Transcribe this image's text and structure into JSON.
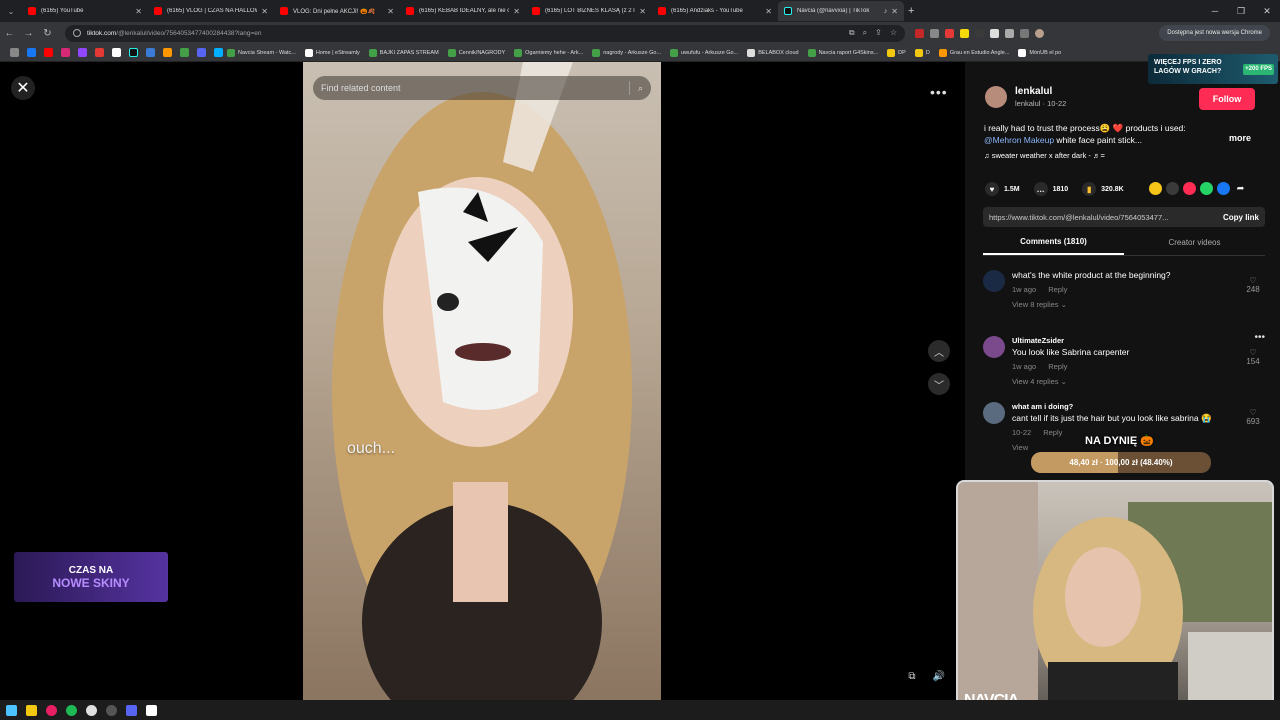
{
  "browser": {
    "tabs": [
      {
        "title": "(6165) YouTube",
        "kind": "yt"
      },
      {
        "title": "(6165) VLOG | CZAS NA HALLOWE",
        "kind": "yt"
      },
      {
        "title": "VLOG: Dni pełne AKCJI! 🎃🍂",
        "kind": "yt"
      },
      {
        "title": "(6165) KEBAB IDEALNY, ale nie ch",
        "kind": "yt"
      },
      {
        "title": "(6165) LOT BIZNES KLASĄ (z 2 letn",
        "kind": "yt"
      },
      {
        "title": "(6165) Andziaks - YouTube",
        "kind": "yt"
      },
      {
        "title": "Navcia (@navvxia) | TikTok",
        "kind": "tt",
        "active": true
      }
    ],
    "url_host": "tiktok.com",
    "url_path": "/@lenkalul/video/7564053477400284438?lang=en",
    "update_label": "Dostępna jest nowa wersja Chrome",
    "bookmarks": [
      "Navcia Stream - Watc...",
      "Home | eStreamly",
      "BAJKI ZAPAS STREAM",
      "Cennik/NAGRODY",
      "Ogarniemy hehe - Ark...",
      "nagrody - Arkusze Go...",
      "uwufufu - Arkusze Go...",
      "BELABOX cloud",
      "Navcia raport G4Skins...",
      "DP",
      "D",
      "Grau en Estudio Angle...",
      "MónUB el po"
    ]
  },
  "video": {
    "search_placeholder": "Find related content",
    "caption": "ouch..."
  },
  "post": {
    "username": "lenkalul",
    "meta": "lenkalul · 10-22",
    "follow_label": "Follow",
    "description": "i really had to trust the process😩 ❤️ products i used:",
    "mention": "@Mehron Makeup",
    "description_tail": " white face paint stick...",
    "more_label": "more",
    "music": "♫  sweater weather x after dark - ♬=",
    "likes": "1.5M",
    "comments": "1810",
    "saves": "320.8K",
    "link": "https://www.tiktok.com/@lenkalul/video/7564053477...",
    "copy_label": "Copy link",
    "tab_comments": "Comments (1810)",
    "tab_creator": "Creator videos"
  },
  "comments": [
    {
      "name": "",
      "text": "what's the white product at the beginning?",
      "time": "1w ago",
      "reply": "Reply",
      "replies": "View 8 replies ⌄",
      "likes": "248",
      "avatar": "#1b2a44"
    },
    {
      "name": "UltimateZsider",
      "text": "You look like Sabrina carpenter",
      "time": "1w ago",
      "reply": "Reply",
      "replies": "View 4 replies ⌄",
      "likes": "154",
      "avatar": "#7a4a8c"
    },
    {
      "name": "what am i doing?",
      "text": "cant tell if its just the hair but you look like sabrina 😭",
      "time": "10-22",
      "reply": "Reply",
      "replies": "View",
      "likes": "693",
      "avatar": "#5a6b80"
    }
  ],
  "overlays": {
    "goal_title": "NA DYNIĘ 🎃",
    "goal_text": "48,40 zł · 100,00 zł (48.40%)",
    "goal_fraction": 0.484,
    "cam_brand": "NAVCIA",
    "promo_line1": "WIĘCEJ FPS I ZERO",
    "promo_line2": "LAGÓW W GRACH?",
    "promo_badge": "+200 FPS",
    "skiny_line1": "CZAS NA",
    "skiny_line2": "NOWE SKINY"
  }
}
